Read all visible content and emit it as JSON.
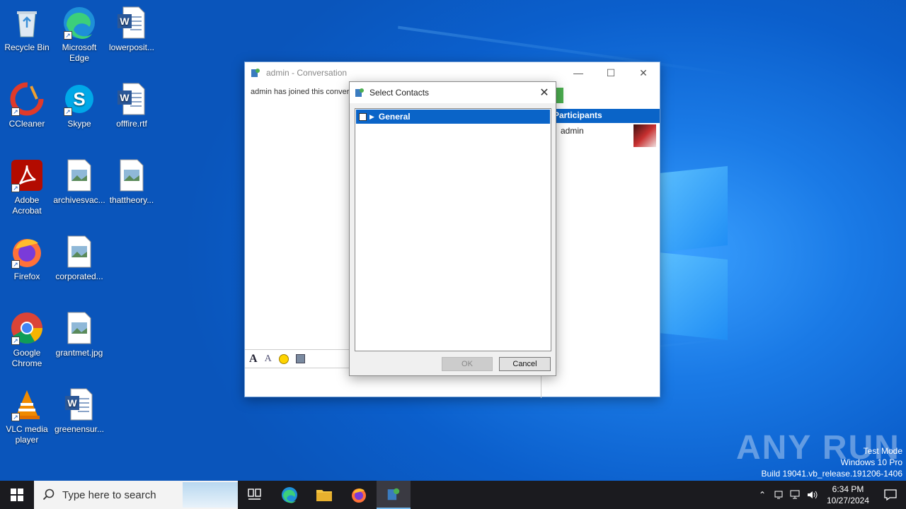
{
  "desktop_icons": [
    {
      "label": "Recycle Bin",
      "icon": "recycle-bin-icon"
    },
    {
      "label": "Microsoft Edge",
      "icon": "edge-icon"
    },
    {
      "label": "lowerposit...",
      "icon": "word-doc-icon"
    },
    {
      "label": "CCleaner",
      "icon": "ccleaner-icon"
    },
    {
      "label": "Skype",
      "icon": "skype-icon"
    },
    {
      "label": "offfire.rtf",
      "icon": "word-doc-icon"
    },
    {
      "label": "Adobe Acrobat",
      "icon": "acrobat-icon"
    },
    {
      "label": "archivesvac...",
      "icon": "image-file-icon"
    },
    {
      "label": "thattheory...",
      "icon": "image-file-icon"
    },
    {
      "label": "Firefox",
      "icon": "firefox-icon"
    },
    {
      "label": "corporated...",
      "icon": "image-file-icon"
    },
    {
      "label": "Google Chrome",
      "icon": "chrome-icon"
    },
    {
      "label": "grantmet.jpg",
      "icon": "image-file-icon"
    },
    {
      "label": "VLC media player",
      "icon": "vlc-icon"
    },
    {
      "label": "greenensur...",
      "icon": "word-doc-icon"
    }
  ],
  "conversation_window": {
    "title": "admin - Conversation",
    "message": "admin has joined this convers",
    "participants_header": "Participants",
    "participant_name": "admin"
  },
  "select_contacts_dialog": {
    "title": "Select Contacts",
    "group_label": "General",
    "ok_label": "OK",
    "cancel_label": "Cancel"
  },
  "watermark": {
    "brand": "ANY RUN",
    "line1": "Test Mode",
    "line2": "Windows 10 Pro",
    "line3": "Build 19041.vb_release.191206-1406"
  },
  "taskbar": {
    "search_placeholder": "Type here to search",
    "time": "6:34 PM",
    "date": "10/27/2024"
  },
  "colors": {
    "accent": "#0078d7",
    "selection": "#0a64c8",
    "taskbar": "#1b1b1f"
  }
}
